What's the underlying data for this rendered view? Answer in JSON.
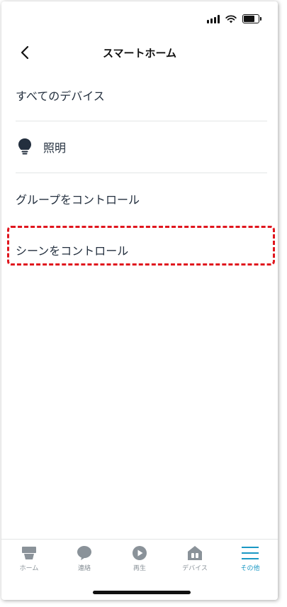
{
  "header": {
    "title": "スマートホーム"
  },
  "menu": {
    "items": [
      {
        "label": "すべてのデバイス"
      },
      {
        "label": "照明"
      },
      {
        "label": "グループをコントロール"
      },
      {
        "label": "シーンをコントロール"
      }
    ]
  },
  "tabs": [
    {
      "label": "ホーム",
      "icon": "home-icon"
    },
    {
      "label": "連絡",
      "icon": "chat-bubble-icon"
    },
    {
      "label": "再生",
      "icon": "play-icon"
    },
    {
      "label": "デバイス",
      "icon": "devices-icon"
    },
    {
      "label": "その他",
      "icon": "menu-lines-icon",
      "active": true
    }
  ],
  "colors": {
    "accent": "#1a98c4",
    "highlight": "#e0161e",
    "text": "#232f3e"
  }
}
